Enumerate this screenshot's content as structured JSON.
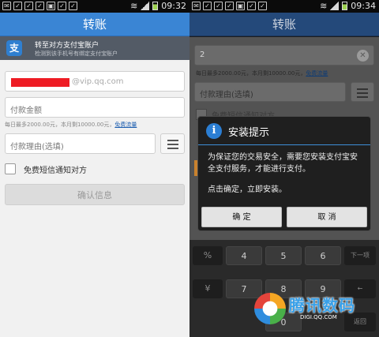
{
  "left": {
    "statusbar": {
      "time": "09:32"
    },
    "title": "转账",
    "banner": {
      "title": "转至对方支付宝账户",
      "subtitle": "检测到该手机号有绑定支付宝账户"
    },
    "email_suffix": "@vip.qq.com",
    "amount_placeholder": "付款金额",
    "limit_hint": "每日最多2000.00元，本月剩10000.00元",
    "limit_link": "免费流量",
    "reason_placeholder": "付款理由(选填)",
    "sms_label": "免费短信通知对方",
    "confirm_label": "确认信息"
  },
  "right": {
    "statusbar": {
      "time": "09:34"
    },
    "title": "转账",
    "amount_value": "2",
    "limit_hint": "每日最多2000.00元，本月剩10000.00元",
    "limit_link": "免费流量",
    "reason_placeholder": "付款理由(选填)",
    "sms_label": "免费短信通知对方",
    "dialog": {
      "title": "安装提示",
      "message": "为保证您的交易安全，需要您安装支付宝安全支付服务，才能进行支付。",
      "message2": "点击确定，立即安装。",
      "ok": "确 定",
      "cancel": "取 消"
    },
    "keyboard": {
      "row1": [
        "%",
        "4",
        "5",
        "6",
        "下一项"
      ],
      "row2": [
        "¥",
        "7",
        "8",
        "9",
        "←"
      ],
      "row3": [
        "",
        "0",
        ".",
        "返回"
      ]
    }
  },
  "watermark": {
    "text": "腾讯数码",
    "url": "DIGI.QQ.COM"
  },
  "colors": {
    "title_bar": "#3a85d4",
    "accent_link": "#1f5fb0",
    "redaction": "#ee1c24"
  }
}
